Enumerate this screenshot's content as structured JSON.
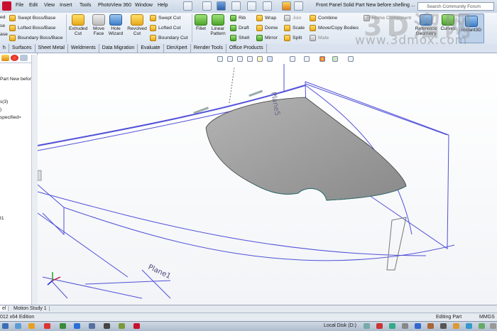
{
  "menubar": {
    "items": [
      "File",
      "Edit",
      "View",
      "Insert",
      "Tools",
      "PhotoView 360",
      "Window",
      "Help"
    ],
    "doc_title": "Front Panel Solid Part New before shelling ...",
    "search_placeholder": "Search Community Forum"
  },
  "ribbon": {
    "left_partial": [
      "ed",
      "se",
      "ase"
    ],
    "boss_base": [
      "Swept Boss/Base",
      "Lofted Boss/Base",
      "Boundary Boss/Base"
    ],
    "cut_buttons": [
      [
        "Extruded",
        "Cut"
      ],
      [
        "Move",
        "Face"
      ],
      [
        "Hole",
        "Wizard"
      ],
      [
        "Revolved",
        "Cut"
      ]
    ],
    "cut_small": [
      "Swept Cut",
      "Lofted Cut",
      "Boundary Cut"
    ],
    "fillet": "Fillet",
    "linear_pattern": [
      "Linear",
      "Pattern"
    ],
    "features_col1": [
      "Rib",
      "Draft",
      "Shell"
    ],
    "features_col2": [
      "Wrap",
      "Dome",
      "Mirror"
    ],
    "features_col3": [
      "Join",
      "Scale",
      "Split"
    ],
    "features_col4": [
      "Combine",
      "Move/Copy Bodies",
      "Mate"
    ],
    "home_component": "Home Component",
    "ref_geometry": [
      "Reference",
      "Geometry"
    ],
    "curves": "Curves",
    "instant3d": "Instant3D"
  },
  "tabs": [
    "h",
    "Surfaces",
    "Sheet Metal",
    "Weldments",
    "Data Migration",
    "Evaluate",
    "DimXpert",
    "Render Tools",
    "Office Products"
  ],
  "tree": {
    "lines": [
      "Part New befor",
      "s(3)",
      ")",
      "specified>",
      "t1"
    ]
  },
  "viewport": {
    "plane5_label": "Plane5",
    "plane1_label": "Plane1"
  },
  "bottom_tabs": [
    "el",
    "Motion Study 1"
  ],
  "status": {
    "left": "012 x64 Edition",
    "mode": "Editing Part",
    "units": "MMGS"
  },
  "taskbar": {
    "drive": "Local Disk (D:)"
  },
  "watermark": {
    "big": "3D溜网",
    "url": "www.3dmox.com"
  },
  "colors": {
    "plane_lines": "#3a3ad0",
    "surface_fill": "#9c9c9c",
    "ribbon_bg": "#e6edf5"
  }
}
